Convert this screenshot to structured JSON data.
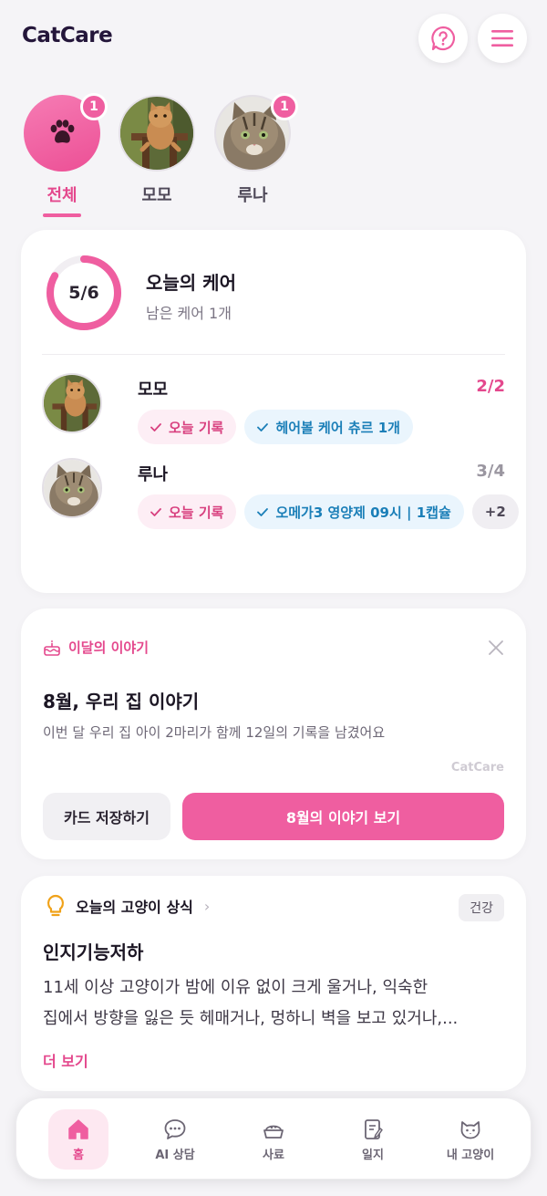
{
  "header": {
    "app_title": "CatCare",
    "help_icon": "question-circle-icon",
    "menu_icon": "hamburger-menu-icon"
  },
  "cat_tabs": [
    {
      "label": "전체",
      "badge": "1",
      "active": true,
      "icon": "paw-icon"
    },
    {
      "label": "모모",
      "badge": "",
      "active": false
    },
    {
      "label": "루나",
      "badge": "1",
      "active": false
    }
  ],
  "today_care": {
    "progress_text": "5/6",
    "progress": {
      "done": 5,
      "total": 6
    },
    "title": "오늘의 케어",
    "subtitle": "남은 케어 1개",
    "pets": [
      {
        "name": "모모",
        "count": "2/2",
        "count_color": "#e4488d",
        "chips": [
          {
            "label": "오늘 기록",
            "style": "pink"
          },
          {
            "label": "헤어볼 케어 츄르 1개",
            "style": "blue"
          }
        ]
      },
      {
        "name": "루나",
        "count": "3/4",
        "count_color": "#9a96a0",
        "chips": [
          {
            "label": "오늘 기록",
            "style": "pink"
          },
          {
            "label": "오메가3 영양제 09시 | 1캡슐",
            "style": "blue"
          }
        ],
        "more": "+2"
      }
    ]
  },
  "story": {
    "label": "이달의 이야기",
    "title": "8월, 우리 집 이야기",
    "description": "이번 달 우리 집 아이 2마리가 함께 12일의 기록을 남겼어요",
    "brand": "CatCare",
    "save_button": "카드 저장하기",
    "view_button": "8월의 이야기 보기"
  },
  "tip": {
    "header": "오늘의 고양이 상식",
    "chevron": "›",
    "tag": "건강",
    "title": "인지기능저하",
    "body_line1": "11세 이상 고양이가 밤에 이유 없이 크게 울거나, 익숙한",
    "body_line2": "집에서 방향을 잃은 듯 헤매거나, 멍하니 벽을 보고 있거나,...",
    "more": "더 보기"
  },
  "bottom_nav": [
    {
      "label": "홈",
      "icon": "home-icon",
      "active": true
    },
    {
      "label": "AI 상담",
      "icon": "chat-bubble-icon",
      "active": false
    },
    {
      "label": "사료",
      "icon": "food-bowl-icon",
      "active": false
    },
    {
      "label": "일지",
      "icon": "notebook-icon",
      "active": false
    },
    {
      "label": "내 고양이",
      "icon": "cat-face-icon",
      "active": false
    }
  ],
  "colors": {
    "accent": "#ef5ea0",
    "accent_text": "#e4488d",
    "blue_chip_text": "#1b7fb8",
    "background": "#f5f4f7"
  }
}
